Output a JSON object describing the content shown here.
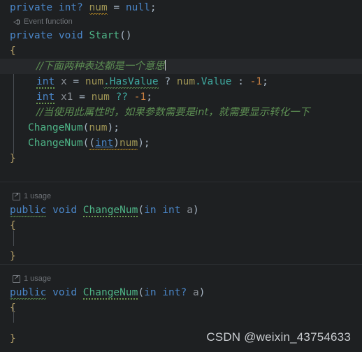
{
  "editor": {
    "theme": "darcula",
    "background": "#1e2022",
    "current_line_background": "#26282b",
    "language": "C#"
  },
  "colors": {
    "keyword": "#4a86c8",
    "method": "#4eb487",
    "field": "#9e9454",
    "property": "#3fa9a0",
    "local_variable": "#8a8f96",
    "number": "#cc8242",
    "comment": "#5d8f53",
    "brace": "#b9a36a",
    "hint_text": "#6e7277",
    "watermark": "#c9ccd0"
  },
  "hints": {
    "event_function": {
      "icon": "unity-event-icon",
      "label": "Event function"
    },
    "usage_one": {
      "icon": "usage-arrow-icon",
      "label": "1 usage"
    },
    "usage_two": {
      "icon": "usage-arrow-icon",
      "label": "1 usage"
    }
  },
  "code": {
    "field_decl": {
      "kw_private": "private",
      "kw_type": "int?",
      "name": "num",
      "eq": " = ",
      "kw_null": "null",
      "semi": ";"
    },
    "start_method": {
      "kw_private": "private",
      "kw_void": "void",
      "name": "Start",
      "parens": "()",
      "open_brace": "{",
      "close_brace": "}",
      "comment1": "//下面两种表达都是一个意思",
      "line_x": {
        "kw_int": "int",
        "var": "x",
        "eq": "= ",
        "obj": "num",
        "prop_has_value": ".HasValue",
        "question": "? ",
        "obj2": "num",
        "prop_value": ".Value",
        "colon": ": ",
        "number": "-1",
        "semi": ";"
      },
      "line_x1": {
        "kw_int": "int",
        "var": "x1",
        "eq": "= ",
        "obj": "num",
        "coalesce": "?? ",
        "number": "-1",
        "semi": ";"
      },
      "comment2": "//当使用此属性时，如果参数需要是int，就需要显示转化一下",
      "call1": {
        "method": "ChangeNum",
        "open": "(",
        "arg": "num",
        "close": ")",
        "semi": ";"
      },
      "call2": {
        "method": "ChangeNum",
        "open": "(",
        "cast_open": "(",
        "cast_type": "int",
        "cast_close": ")",
        "arg": "num",
        "close": ")",
        "semi": ";"
      }
    },
    "change_num_int": {
      "kw_public": "public",
      "kw_void": "void",
      "name": "ChangeNum",
      "paren_open": "(",
      "modifier": "in",
      "param_type": "int",
      "param_name": "a",
      "paren_close": ")",
      "open_brace": "{",
      "close_brace": "}"
    },
    "change_num_nullable": {
      "kw_public": "public",
      "kw_void": "void",
      "name": "ChangeNum",
      "paren_open": "(",
      "modifier": "in",
      "param_type": "int?",
      "param_name": "a",
      "paren_close": ")",
      "open_brace": "{",
      "close_brace": "}"
    }
  },
  "watermark": {
    "text": "CSDN @weixin_43754633"
  }
}
